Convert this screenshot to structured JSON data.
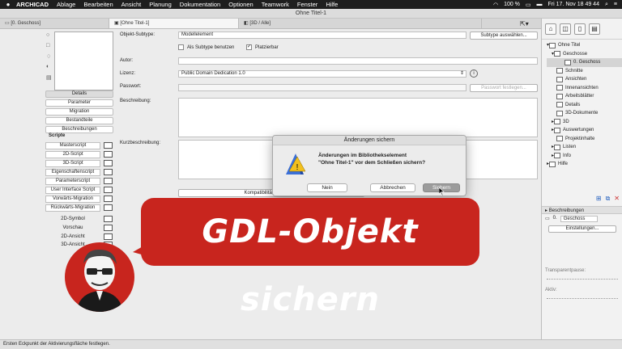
{
  "menubar": {
    "apple": "",
    "app": "ARCHICAD",
    "items": [
      "Ablage",
      "Bearbeiten",
      "Ansicht",
      "Planung",
      "Dokumentation",
      "Optionen",
      "Teamwork",
      "Fenster",
      "Hilfe"
    ],
    "battery": "100 %",
    "clock": "Fri 17. Nov 18 49 44"
  },
  "window": {
    "title": "Ohne Titel-1"
  },
  "tabs": [
    "[0. Geschoss]",
    "[Ohne Titel-1]",
    "[3D / Alle]"
  ],
  "left": {
    "nav": [
      "Details",
      "Parameter",
      "Migration",
      "Bestandteile",
      "Beschreibungen"
    ],
    "scripts_label": "Scripte",
    "scripts": [
      "Masterscript",
      "2D-Script",
      "3D-Script",
      "Eigenschaftenscript",
      "Parameterscript",
      "User Interface Script",
      "Vorwärts-Migration",
      "Rückwärts-Migration"
    ],
    "views": [
      "2D-Symbol",
      "Vorschau",
      "2D-Ansicht",
      "3D-Ansicht"
    ]
  },
  "form": {
    "subtype_label": "Objekt-Subtype:",
    "subtype_value": "Modellelement",
    "subtype_button": "Subtype auswählen...",
    "use_subtype_label": "Als Subtype benutzen",
    "placeable_label": "Platzierbar",
    "author_label": "Autor:",
    "license_label": "Lizenz:",
    "license_value": "Public Domain Dedication 1.0",
    "password_label": "Passwort:",
    "password_button": "Passwort festlegen...",
    "description_label": "Beschreibung:",
    "short_description_label": "Kurzbeschreibung:",
    "compat_button": "Kompatibilitätsoptionen..."
  },
  "dialog": {
    "title": "Änderungen sichern",
    "line1": "Änderungen im Bibliothekselement",
    "line2": "\"Ohne Titel-1\" vor dem Schließen sichern?",
    "no": "Nein",
    "cancel": "Abbrechen",
    "save": "Sichern"
  },
  "navigator": {
    "tree": [
      "Ohne Titel",
      "Geschosse",
      "0. Geschoss",
      "Schnitte",
      "Ansichten",
      "Innenansichten",
      "Arbeitsblätter",
      "Details",
      "3D-Dokumente",
      "3D",
      "Auswertungen",
      "Projektinhalte",
      "Listen",
      "Info",
      "Hilfe"
    ],
    "panel_title": "Beschreibungen",
    "story_num": "0.",
    "story_name": "Geschoss",
    "settings_button": "Einstellungen...",
    "transparency_label": "Transparentpause:",
    "active_label": "Aktiv:"
  },
  "status": {
    "text": "Ersten Eckpunkt der Aktivierungsfläche festlegen."
  },
  "banner": {
    "text": "GDL-Objekt sichern",
    "color": "#c8251e"
  }
}
